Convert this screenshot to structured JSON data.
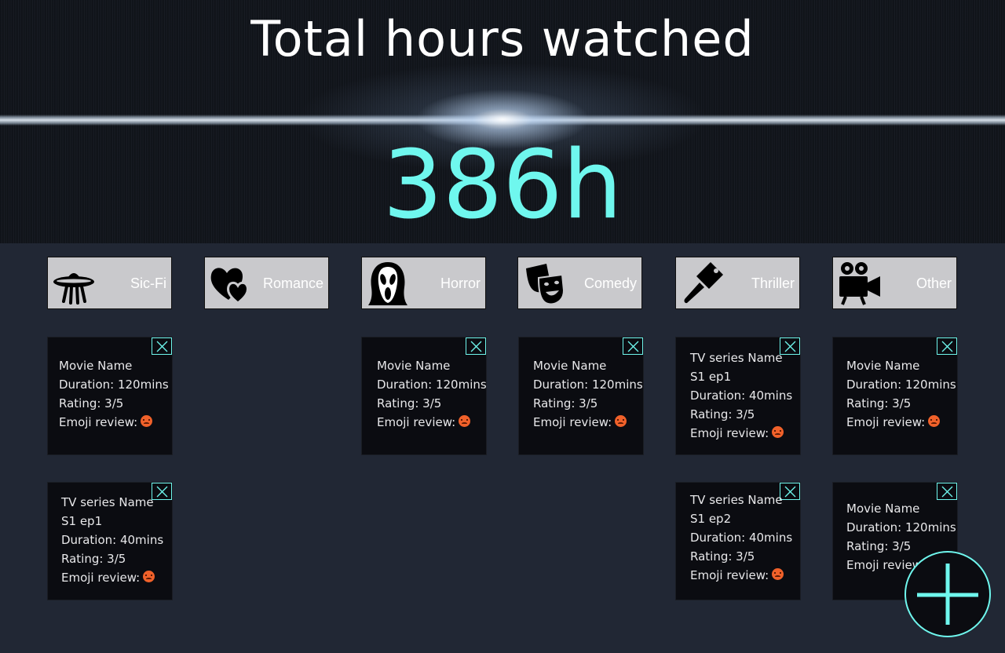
{
  "header": {
    "title": "Total hours watched",
    "total": "386h"
  },
  "colors": {
    "accent": "#6ff7ee",
    "background": "#212734",
    "card": "#0b0c11",
    "genre_tile": "#c9c9cc",
    "emoji": "#f0612a"
  },
  "genres": [
    {
      "label": "Sic-Fi",
      "icon": "ufo-icon"
    },
    {
      "label": "Romance",
      "icon": "heart-icon"
    },
    {
      "label": "Horror",
      "icon": "scream-mask-icon"
    },
    {
      "label": "Comedy",
      "icon": "theater-masks-icon"
    },
    {
      "label": "Thriller",
      "icon": "cleaver-icon"
    },
    {
      "label": "Other",
      "icon": "movie-camera-icon"
    }
  ],
  "cards": {
    "scifi_1": [
      "Movie Name",
      "Duration: 120mins",
      "Rating: 3/5",
      "Emoji review:"
    ],
    "scifi_2": [
      "TV series Name",
      "S1 ep1",
      "Duration: 40mins",
      "Rating: 3/5",
      "Emoji review:"
    ],
    "horror_1": [
      "Movie Name",
      "Duration: 120mins",
      "Rating: 3/5",
      "Emoji review:"
    ],
    "comedy_1": [
      "Movie Name",
      "Duration: 120mins",
      "Rating: 3/5",
      "Emoji review:"
    ],
    "thriller_1": [
      "TV series Name",
      "S1 ep1",
      "Duration: 40mins",
      "Rating: 3/5",
      "Emoji review:"
    ],
    "thriller_2": [
      "TV series Name",
      "S1 ep2",
      "Duration: 40mins",
      "Rating: 3/5",
      "Emoji review:"
    ],
    "other_1": [
      "Movie Name",
      "Duration: 120mins",
      "Rating: 3/5",
      "Emoji review:"
    ],
    "other_2": [
      "Movie Name",
      "Duration: 120mins",
      "Rating: 3/5",
      "Emoji review:"
    ]
  },
  "icons": {
    "close": "close-icon",
    "emoji_review": "angry-face-emoji-icon",
    "add": "plus-icon"
  }
}
